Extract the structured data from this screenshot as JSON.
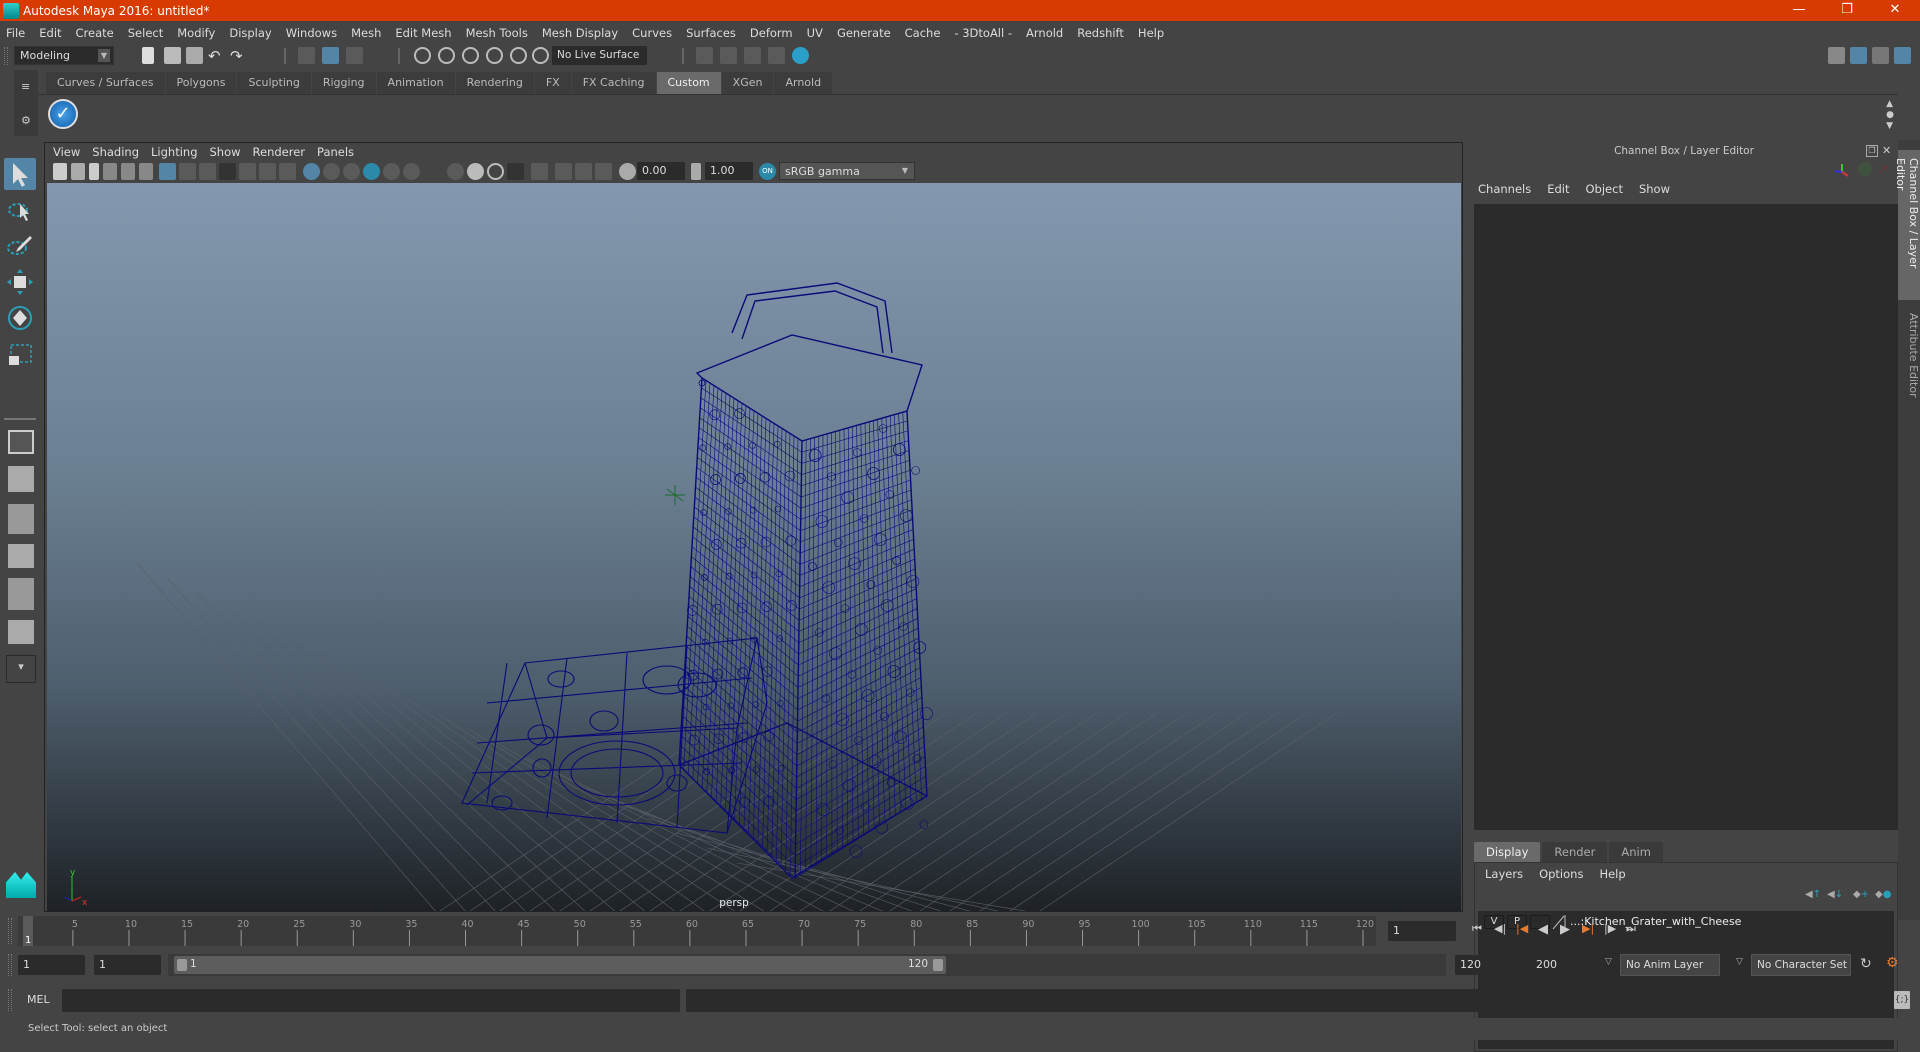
{
  "app": {
    "title": "Autodesk Maya 2016: untitled*",
    "window_buttons": [
      "minimize",
      "maximize",
      "close"
    ],
    "accent_color": "#d83b01"
  },
  "menubar": [
    "File",
    "Edit",
    "Create",
    "Select",
    "Modify",
    "Display",
    "Windows",
    "Mesh",
    "Edit Mesh",
    "Mesh Tools",
    "Mesh Display",
    "Curves",
    "Surfaces",
    "Deform",
    "UV",
    "Generate",
    "Cache",
    "- 3DtoAll -",
    "Arnold",
    "Redshift",
    "Help"
  ],
  "statusline": {
    "menuset": "Modeling",
    "live_surface": "No Live Surface"
  },
  "shelf": {
    "tabs": [
      "Curves / Surfaces",
      "Polygons",
      "Sculpting",
      "Rigging",
      "Animation",
      "Rendering",
      "FX",
      "FX Caching",
      "Custom",
      "XGen",
      "Arnold"
    ],
    "active_tab": "Custom",
    "items": [
      {
        "icon": "checkmark-script-icon"
      }
    ]
  },
  "toolbox": {
    "tools": [
      {
        "name": "select-tool",
        "active": true
      },
      {
        "name": "lasso-tool",
        "active": false
      },
      {
        "name": "paint-select-tool",
        "active": false
      },
      {
        "name": "move-tool",
        "active": false
      },
      {
        "name": "rotate-tool",
        "active": false
      },
      {
        "name": "scale-tool",
        "active": false
      }
    ]
  },
  "viewport": {
    "menu": [
      "View",
      "Shading",
      "Lighting",
      "Show",
      "Renderer",
      "Panels"
    ],
    "exposure": "0.00",
    "gamma": "1.00",
    "color_space": "sRGB gamma",
    "camera_label": "persp",
    "wireframe_color": "#0a0a78",
    "axis": {
      "y": "y",
      "x": "x"
    }
  },
  "channel_box": {
    "title": "Channel Box / Layer Editor",
    "menu": [
      "Channels",
      "Edit",
      "Object",
      "Show"
    ],
    "layer_tabs": [
      "Display",
      "Render",
      "Anim"
    ],
    "active_layer_tab": "Display",
    "layer_menu": [
      "Layers",
      "Options",
      "Help"
    ],
    "layers": [
      {
        "visible": "V",
        "playback": "P",
        "name": "...:Kitchen_Grater_with_Cheese"
      }
    ]
  },
  "side_tabs": [
    "Channel Box / Layer Editor",
    "Attribute Editor"
  ],
  "timeline": {
    "start": 1,
    "end": 120,
    "current_frame": "1",
    "tick_labels": [
      5,
      10,
      15,
      20,
      25,
      30,
      35,
      40,
      45,
      50,
      55,
      60,
      65,
      70,
      75,
      80,
      85,
      90,
      95,
      100,
      105,
      110,
      115,
      120
    ]
  },
  "range": {
    "start_frame": "1",
    "playback_start": "1",
    "slider_min": "1",
    "slider_max": "120",
    "playback_end": "120",
    "end_frame": "200",
    "anim_layer": "No Anim Layer",
    "character_set": "No Character Set"
  },
  "command_line": {
    "language": "MEL",
    "input": "",
    "result": ""
  },
  "help_line": "Select Tool: select an object"
}
